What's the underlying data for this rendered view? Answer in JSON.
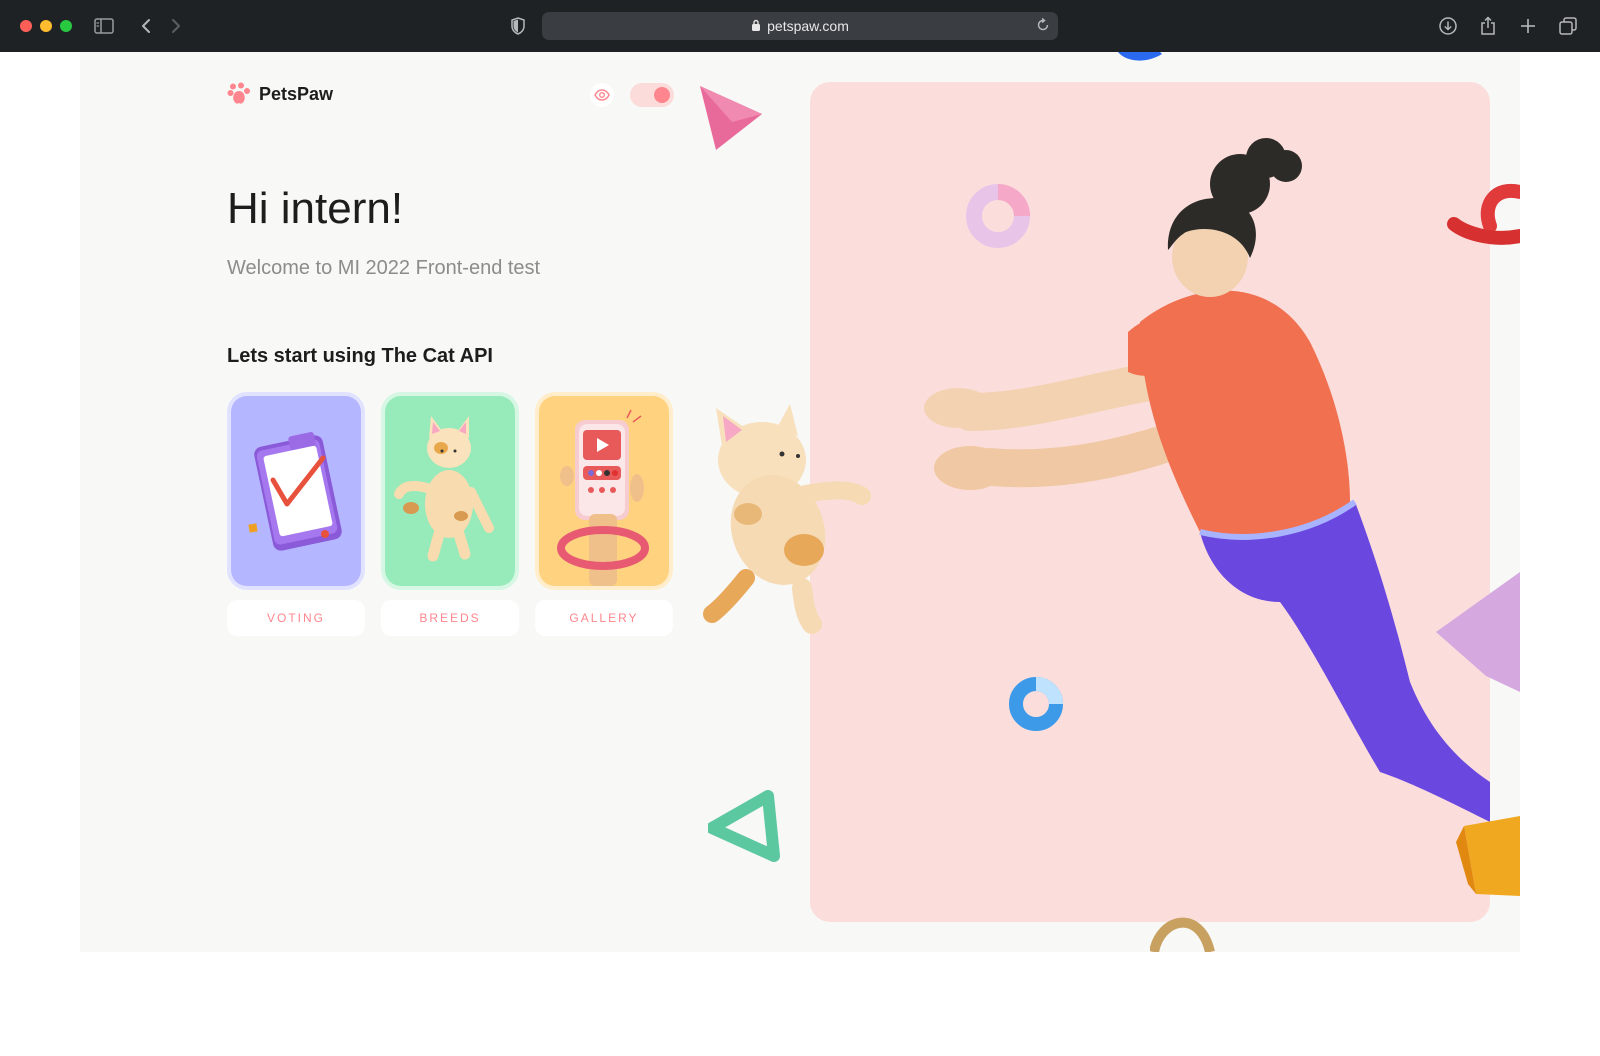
{
  "browser": {
    "url": "petspaw.com",
    "icons": [
      "sidebar-icon",
      "back-icon",
      "forward-icon",
      "shield-icon",
      "lock-icon",
      "reload-icon",
      "download-icon",
      "share-icon",
      "new-tab-icon",
      "tabs-overview-icon"
    ]
  },
  "header": {
    "logo_text": "PetsPaw",
    "accent_color": "#ff868e"
  },
  "main": {
    "greeting": "Hi intern!",
    "welcome": "Welcome to MI 2022 Front-end test",
    "lets_start": "Lets start using The Cat API"
  },
  "cards": [
    {
      "label": "VOTING",
      "color": "#b4b7ff"
    },
    {
      "label": "BREEDS",
      "color": "#97eab9"
    },
    {
      "label": "GALLERY",
      "color": "#ffd280"
    }
  ],
  "hero": {
    "background": "#fbdedc"
  }
}
